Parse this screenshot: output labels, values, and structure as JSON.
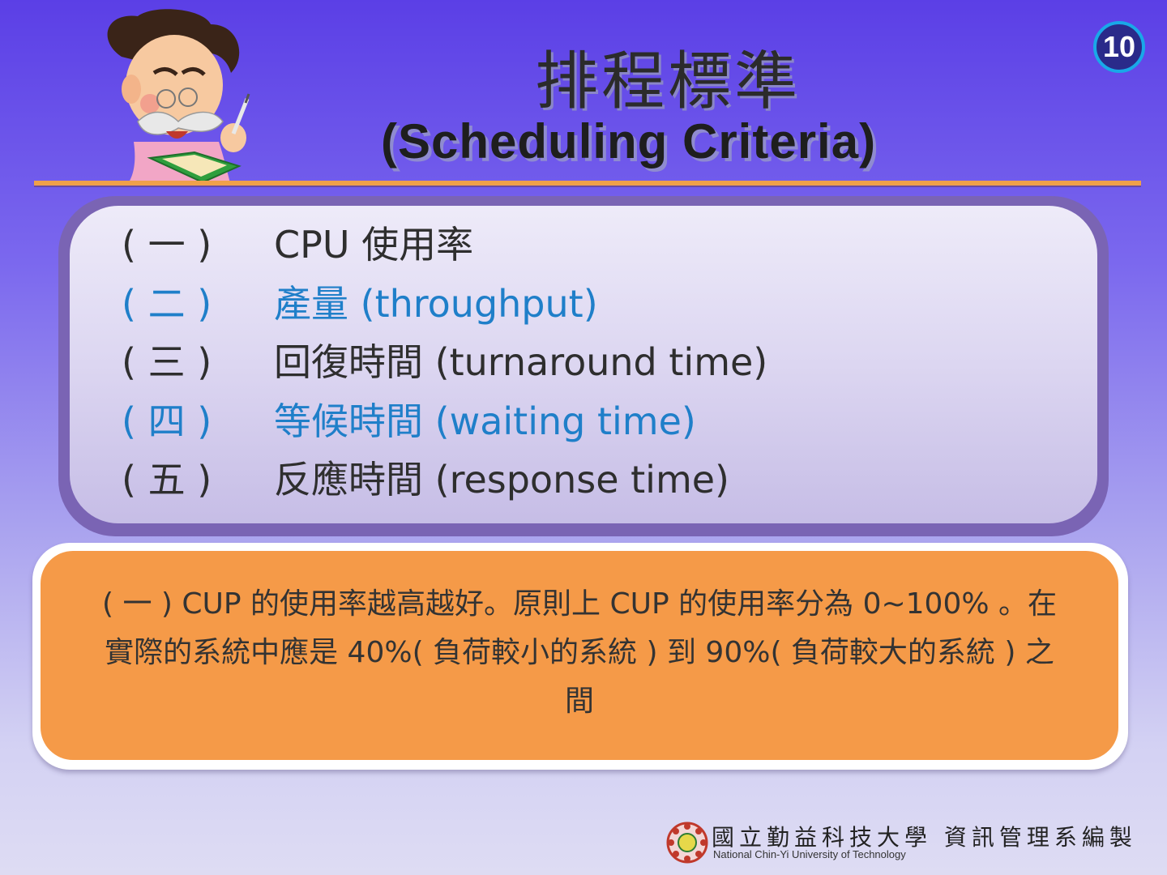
{
  "page_number": "10",
  "title": {
    "chinese": "排程標準",
    "english": "(Scheduling Criteria)"
  },
  "criteria": [
    {
      "num": "( 一 )",
      "text": "CPU 使用率",
      "color": "#2e2e2e"
    },
    {
      "num": "( 二 )",
      "text": "產量  (throughput)",
      "color": "#1f7fc9"
    },
    {
      "num": "( 三 )",
      "text": "回復時間  (turnaround time)",
      "color": "#2e2e2e"
    },
    {
      "num": "( 四 )",
      "text": "等候時間  (waiting time)",
      "color": "#1f7fc9"
    },
    {
      "num": "( 五 )",
      "text": "反應時間 (response time)",
      "color": "#2e2e2e"
    }
  ],
  "note": {
    "line1": "( 一 ) CUP 的使用率越高越好。原則上 CUP 的使用率分為 0~100% 。在",
    "line2": "實際的系統中應是 40%( 負荷較小的系統 ) 到 90%( 負荷較大的系統 ) 之",
    "line3": "間"
  },
  "footer": {
    "chinese": "國立勤益科技大學 資訊管理系編製",
    "english": "National Chin-Yi University of Technology"
  },
  "colors": {
    "accent_orange": "#f59a48",
    "divider": "#f0a04a",
    "panel_border": "#7a64b4",
    "highlight_blue": "#1f7fc9"
  },
  "icons": {
    "mascot": "professor-reading-book-icon",
    "logo": "university-seal-icon"
  }
}
